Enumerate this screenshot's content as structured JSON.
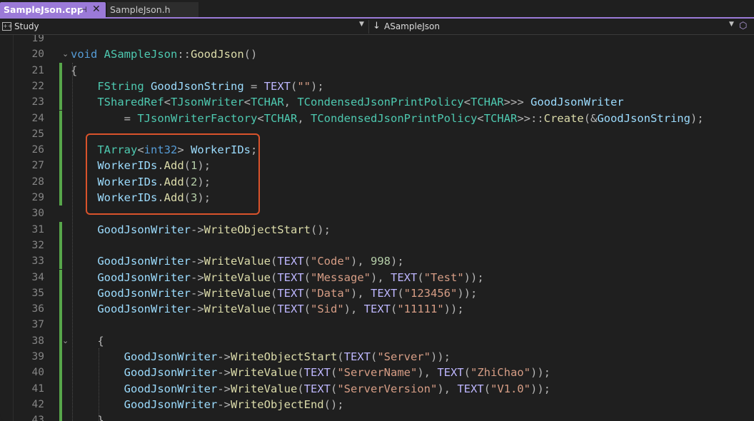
{
  "tabs": [
    {
      "label": "SampleJson.cpp",
      "active": true,
      "pin_icon": "pin-icon",
      "close_icon": "close-icon"
    },
    {
      "label": "SampleJson.h",
      "active": false
    }
  ],
  "navbar": {
    "scope": "Study",
    "member": "ASampleJson"
  },
  "colors": {
    "accent": "#9b7ad8",
    "change_bar": "#57a64a",
    "highlight_box": "#d9532b",
    "keyword": "#569cd6",
    "type": "#4ec9b0",
    "function": "#dcdcaa",
    "macro": "#beb7ff",
    "variable": "#9cdcfe",
    "string": "#d69d85",
    "number": "#b5cea8"
  },
  "code_lines": [
    {
      "n": "19",
      "changed": false,
      "fold": "",
      "segs": []
    },
    {
      "n": "20",
      "changed": false,
      "fold": "⌄",
      "segs": [
        [
          "kw",
          "void"
        ],
        [
          "pn",
          " "
        ],
        [
          "ty",
          "ASampleJson"
        ],
        [
          "pn",
          "::"
        ],
        [
          "fn",
          "GoodJson"
        ],
        [
          "pn",
          "()"
        ]
      ]
    },
    {
      "n": "21",
      "changed": true,
      "fold": "",
      "segs": [
        [
          "pn",
          "{"
        ]
      ]
    },
    {
      "n": "22",
      "changed": true,
      "fold": "",
      "segs": [
        [
          "pn",
          "    "
        ],
        [
          "ty",
          "FString"
        ],
        [
          "pn",
          " "
        ],
        [
          "vr",
          "GoodJsonString"
        ],
        [
          "pn",
          " = "
        ],
        [
          "mc",
          "TEXT"
        ],
        [
          "pn",
          "("
        ],
        [
          "st",
          "\"\""
        ],
        [
          "pn",
          ");"
        ]
      ]
    },
    {
      "n": "23",
      "changed": true,
      "fold": "",
      "segs": [
        [
          "pn",
          "    "
        ],
        [
          "ty",
          "TSharedRef"
        ],
        [
          "pn",
          "<"
        ],
        [
          "ty",
          "TJsonWriter"
        ],
        [
          "pn",
          "<"
        ],
        [
          "ty",
          "TCHAR"
        ],
        [
          "pn",
          ", "
        ],
        [
          "ty",
          "TCondensedJsonPrintPolicy"
        ],
        [
          "pn",
          "<"
        ],
        [
          "ty",
          "TCHAR"
        ],
        [
          "pn",
          ">>> "
        ],
        [
          "vr",
          "GoodJsonWriter"
        ]
      ]
    },
    {
      "n": "24",
      "changed": true,
      "fold": "",
      "segs": [
        [
          "pn",
          "        = "
        ],
        [
          "ty",
          "TJsonWriterFactory"
        ],
        [
          "pn",
          "<"
        ],
        [
          "ty",
          "TCHAR"
        ],
        [
          "pn",
          ", "
        ],
        [
          "ty",
          "TCondensedJsonPrintPolicy"
        ],
        [
          "pn",
          "<"
        ],
        [
          "ty",
          "TCHAR"
        ],
        [
          "pn",
          ">>::"
        ],
        [
          "fn",
          "Create"
        ],
        [
          "pn",
          "(&"
        ],
        [
          "vr",
          "GoodJsonString"
        ],
        [
          "pn",
          ");"
        ]
      ]
    },
    {
      "n": "25",
      "changed": true,
      "fold": "",
      "segs": []
    },
    {
      "n": "26",
      "changed": true,
      "fold": "",
      "segs": [
        [
          "pn",
          "    "
        ],
        [
          "ty",
          "TArray"
        ],
        [
          "pn",
          "<"
        ],
        [
          "kw",
          "int32"
        ],
        [
          "pn",
          "> "
        ],
        [
          "vr",
          "WorkerIDs"
        ],
        [
          "pn",
          ";"
        ]
      ]
    },
    {
      "n": "27",
      "changed": true,
      "fold": "",
      "segs": [
        [
          "pn",
          "    "
        ],
        [
          "vr",
          "WorkerIDs"
        ],
        [
          "pn",
          "."
        ],
        [
          "fn",
          "Add"
        ],
        [
          "pn",
          "("
        ],
        [
          "nm",
          "1"
        ],
        [
          "pn",
          ");"
        ]
      ]
    },
    {
      "n": "28",
      "changed": true,
      "fold": "",
      "segs": [
        [
          "pn",
          "    "
        ],
        [
          "vr",
          "WorkerIDs"
        ],
        [
          "pn",
          "."
        ],
        [
          "fn",
          "Add"
        ],
        [
          "pn",
          "("
        ],
        [
          "nm",
          "2"
        ],
        [
          "pn",
          ");"
        ]
      ]
    },
    {
      "n": "29",
      "changed": true,
      "fold": "",
      "segs": [
        [
          "pn",
          "    "
        ],
        [
          "vr",
          "WorkerIDs"
        ],
        [
          "pn",
          "."
        ],
        [
          "fn",
          "Add"
        ],
        [
          "pn",
          "("
        ],
        [
          "nm",
          "3"
        ],
        [
          "pn",
          ");"
        ]
      ]
    },
    {
      "n": "30",
      "changed": false,
      "fold": "",
      "segs": []
    },
    {
      "n": "31",
      "changed": true,
      "fold": "",
      "segs": [
        [
          "pn",
          "    "
        ],
        [
          "vr",
          "GoodJsonWriter"
        ],
        [
          "pn",
          "->"
        ],
        [
          "fn",
          "WriteObjectStart"
        ],
        [
          "pn",
          "();"
        ]
      ]
    },
    {
      "n": "32",
      "changed": true,
      "fold": "",
      "segs": []
    },
    {
      "n": "33",
      "changed": true,
      "fold": "",
      "segs": [
        [
          "pn",
          "    "
        ],
        [
          "vr",
          "GoodJsonWriter"
        ],
        [
          "pn",
          "->"
        ],
        [
          "fn",
          "WriteValue"
        ],
        [
          "pn",
          "("
        ],
        [
          "mc",
          "TEXT"
        ],
        [
          "pn",
          "("
        ],
        [
          "st",
          "\"Code\""
        ],
        [
          "pn",
          "), "
        ],
        [
          "nm",
          "998"
        ],
        [
          "pn",
          ");"
        ]
      ]
    },
    {
      "n": "34",
      "changed": true,
      "fold": "",
      "segs": [
        [
          "pn",
          "    "
        ],
        [
          "vr",
          "GoodJsonWriter"
        ],
        [
          "pn",
          "->"
        ],
        [
          "fn",
          "WriteValue"
        ],
        [
          "pn",
          "("
        ],
        [
          "mc",
          "TEXT"
        ],
        [
          "pn",
          "("
        ],
        [
          "st",
          "\"Message\""
        ],
        [
          "pn",
          "), "
        ],
        [
          "mc",
          "TEXT"
        ],
        [
          "pn",
          "("
        ],
        [
          "st",
          "\"Test\""
        ],
        [
          "pn",
          "));"
        ]
      ]
    },
    {
      "n": "35",
      "changed": true,
      "fold": "",
      "segs": [
        [
          "pn",
          "    "
        ],
        [
          "vr",
          "GoodJsonWriter"
        ],
        [
          "pn",
          "->"
        ],
        [
          "fn",
          "WriteValue"
        ],
        [
          "pn",
          "("
        ],
        [
          "mc",
          "TEXT"
        ],
        [
          "pn",
          "("
        ],
        [
          "st",
          "\"Data\""
        ],
        [
          "pn",
          "), "
        ],
        [
          "mc",
          "TEXT"
        ],
        [
          "pn",
          "("
        ],
        [
          "st",
          "\"123456\""
        ],
        [
          "pn",
          "));"
        ]
      ]
    },
    {
      "n": "36",
      "changed": true,
      "fold": "",
      "segs": [
        [
          "pn",
          "    "
        ],
        [
          "vr",
          "GoodJsonWriter"
        ],
        [
          "pn",
          "->"
        ],
        [
          "fn",
          "WriteValue"
        ],
        [
          "pn",
          "("
        ],
        [
          "mc",
          "TEXT"
        ],
        [
          "pn",
          "("
        ],
        [
          "st",
          "\"Sid\""
        ],
        [
          "pn",
          "), "
        ],
        [
          "mc",
          "TEXT"
        ],
        [
          "pn",
          "("
        ],
        [
          "st",
          "\"11111\""
        ],
        [
          "pn",
          "));"
        ]
      ]
    },
    {
      "n": "37",
      "changed": true,
      "fold": "",
      "segs": []
    },
    {
      "n": "38",
      "changed": true,
      "fold": "⌄",
      "segs": [
        [
          "pn",
          "    {"
        ]
      ]
    },
    {
      "n": "39",
      "changed": true,
      "fold": "",
      "segs": [
        [
          "pn",
          "        "
        ],
        [
          "vr",
          "GoodJsonWriter"
        ],
        [
          "pn",
          "->"
        ],
        [
          "fn",
          "WriteObjectStart"
        ],
        [
          "pn",
          "("
        ],
        [
          "mc",
          "TEXT"
        ],
        [
          "pn",
          "("
        ],
        [
          "st",
          "\"Server\""
        ],
        [
          "pn",
          "));"
        ]
      ]
    },
    {
      "n": "40",
      "changed": true,
      "fold": "",
      "segs": [
        [
          "pn",
          "        "
        ],
        [
          "vr",
          "GoodJsonWriter"
        ],
        [
          "pn",
          "->"
        ],
        [
          "fn",
          "WriteValue"
        ],
        [
          "pn",
          "("
        ],
        [
          "mc",
          "TEXT"
        ],
        [
          "pn",
          "("
        ],
        [
          "st",
          "\"ServerName\""
        ],
        [
          "pn",
          "), "
        ],
        [
          "mc",
          "TEXT"
        ],
        [
          "pn",
          "("
        ],
        [
          "st",
          "\"ZhiChao\""
        ],
        [
          "pn",
          "));"
        ]
      ]
    },
    {
      "n": "41",
      "changed": true,
      "fold": "",
      "segs": [
        [
          "pn",
          "        "
        ],
        [
          "vr",
          "GoodJsonWriter"
        ],
        [
          "pn",
          "->"
        ],
        [
          "fn",
          "WriteValue"
        ],
        [
          "pn",
          "("
        ],
        [
          "mc",
          "TEXT"
        ],
        [
          "pn",
          "("
        ],
        [
          "st",
          "\"ServerVersion\""
        ],
        [
          "pn",
          "), "
        ],
        [
          "mc",
          "TEXT"
        ],
        [
          "pn",
          "("
        ],
        [
          "st",
          "\"V1.0\""
        ],
        [
          "pn",
          "));"
        ]
      ]
    },
    {
      "n": "42",
      "changed": true,
      "fold": "",
      "segs": [
        [
          "pn",
          "        "
        ],
        [
          "vr",
          "GoodJsonWriter"
        ],
        [
          "pn",
          "->"
        ],
        [
          "fn",
          "WriteObjectEnd"
        ],
        [
          "pn",
          "();"
        ]
      ]
    },
    {
      "n": "43",
      "changed": true,
      "fold": "",
      "segs": [
        [
          "pn",
          "    }"
        ]
      ]
    }
  ]
}
